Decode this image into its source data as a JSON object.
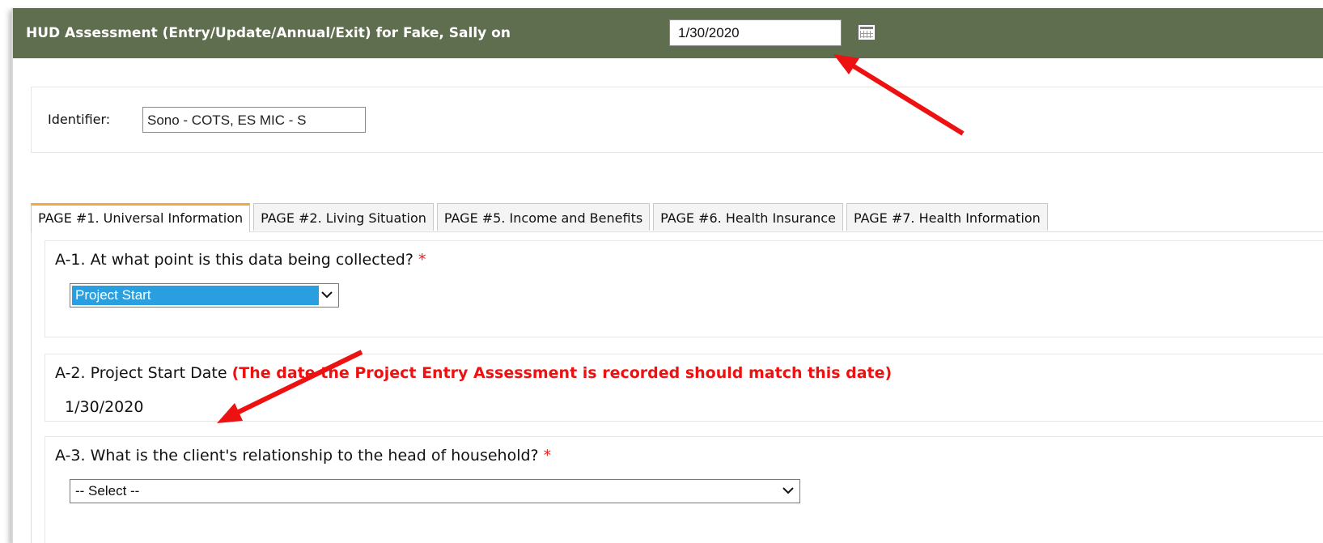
{
  "header": {
    "title": "HUD Assessment (Entry/Update/Annual/Exit) for Fake, Sally on",
    "date_value": "1/30/2020",
    "calendar_icon": "calendar-icon"
  },
  "identifier": {
    "label": "Identifier:",
    "value": "Sono - COTS, ES MIC - S"
  },
  "tabs": [
    {
      "label": "PAGE #1. Universal Information",
      "active": true
    },
    {
      "label": "PAGE #2. Living Situation",
      "active": false
    },
    {
      "label": "PAGE #5. Income and Benefits",
      "active": false
    },
    {
      "label": "PAGE #6. Health Insurance",
      "active": false
    },
    {
      "label": "PAGE #7. Health Information",
      "active": false
    }
  ],
  "questions": {
    "a1": {
      "label": "A-1. At what point is this data being collected?",
      "required_mark": "*",
      "selected": "Project Start"
    },
    "a2": {
      "label": "A-2. Project Start Date",
      "note": "(The date the Project Entry Assessment is recorded should match this date)",
      "value": "1/30/2020"
    },
    "a3": {
      "label": "A-3. What is the client's relationship to the head of household?",
      "required_mark": "*",
      "selected": "-- Select --"
    }
  },
  "colors": {
    "header_bg": "#5e6e4e",
    "active_tab_accent": "#f2a93b",
    "selection_bg": "#2a9fe0",
    "required": "#e32020",
    "note": "#ee1111",
    "annotation_arrow": "#ee1111"
  }
}
